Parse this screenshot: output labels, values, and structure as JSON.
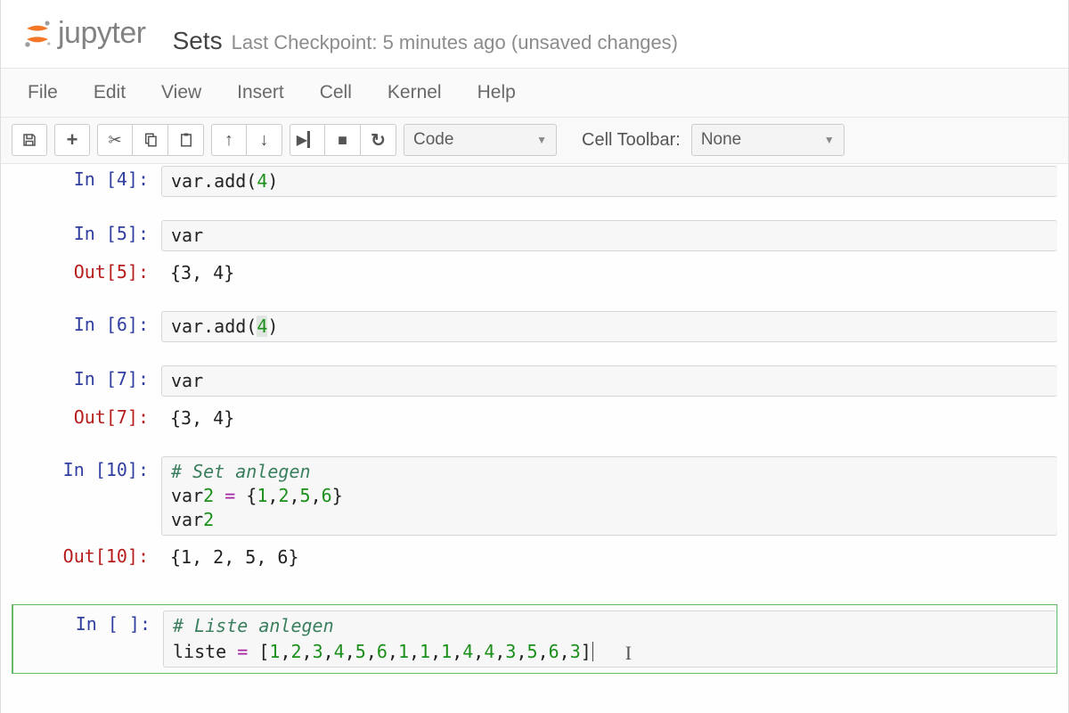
{
  "header": {
    "logo_text": "jupyter",
    "notebook_title": "Sets",
    "checkpoint": "Last Checkpoint: 5 minutes ago (unsaved changes)"
  },
  "menubar": {
    "items": [
      "File",
      "Edit",
      "View",
      "Insert",
      "Cell",
      "Kernel",
      "Help"
    ]
  },
  "toolbar": {
    "celltype_selected": "Code",
    "cell_toolbar_label": "Cell Toolbar:",
    "cell_toolbar_selected": "None"
  },
  "cells": [
    {
      "kind": "in",
      "n": "4",
      "code": "var.add(4)",
      "toprow": true
    },
    {
      "kind": "in",
      "n": "5",
      "code": "var"
    },
    {
      "kind": "out",
      "n": "5",
      "text": "{3, 4}"
    },
    {
      "kind": "in",
      "n": "6",
      "code": "var.add(4)",
      "hl_last": true
    },
    {
      "kind": "in",
      "n": "7",
      "code": "var"
    },
    {
      "kind": "out",
      "n": "7",
      "text": "{3, 4}"
    },
    {
      "kind": "in",
      "n": "10",
      "lines": [
        "# Set anlegen",
        "var2 = {1,2,5,6}",
        "var2"
      ]
    },
    {
      "kind": "out",
      "n": "10",
      "text": "{1, 2, 5, 6}"
    },
    {
      "kind": "in",
      "n": " ",
      "selected": true,
      "lines": [
        "# Liste anlegen",
        "liste = [1,2,3,4,5,6,1,1,1,4,4,3,5,6,3]"
      ],
      "cursor": true
    }
  ]
}
